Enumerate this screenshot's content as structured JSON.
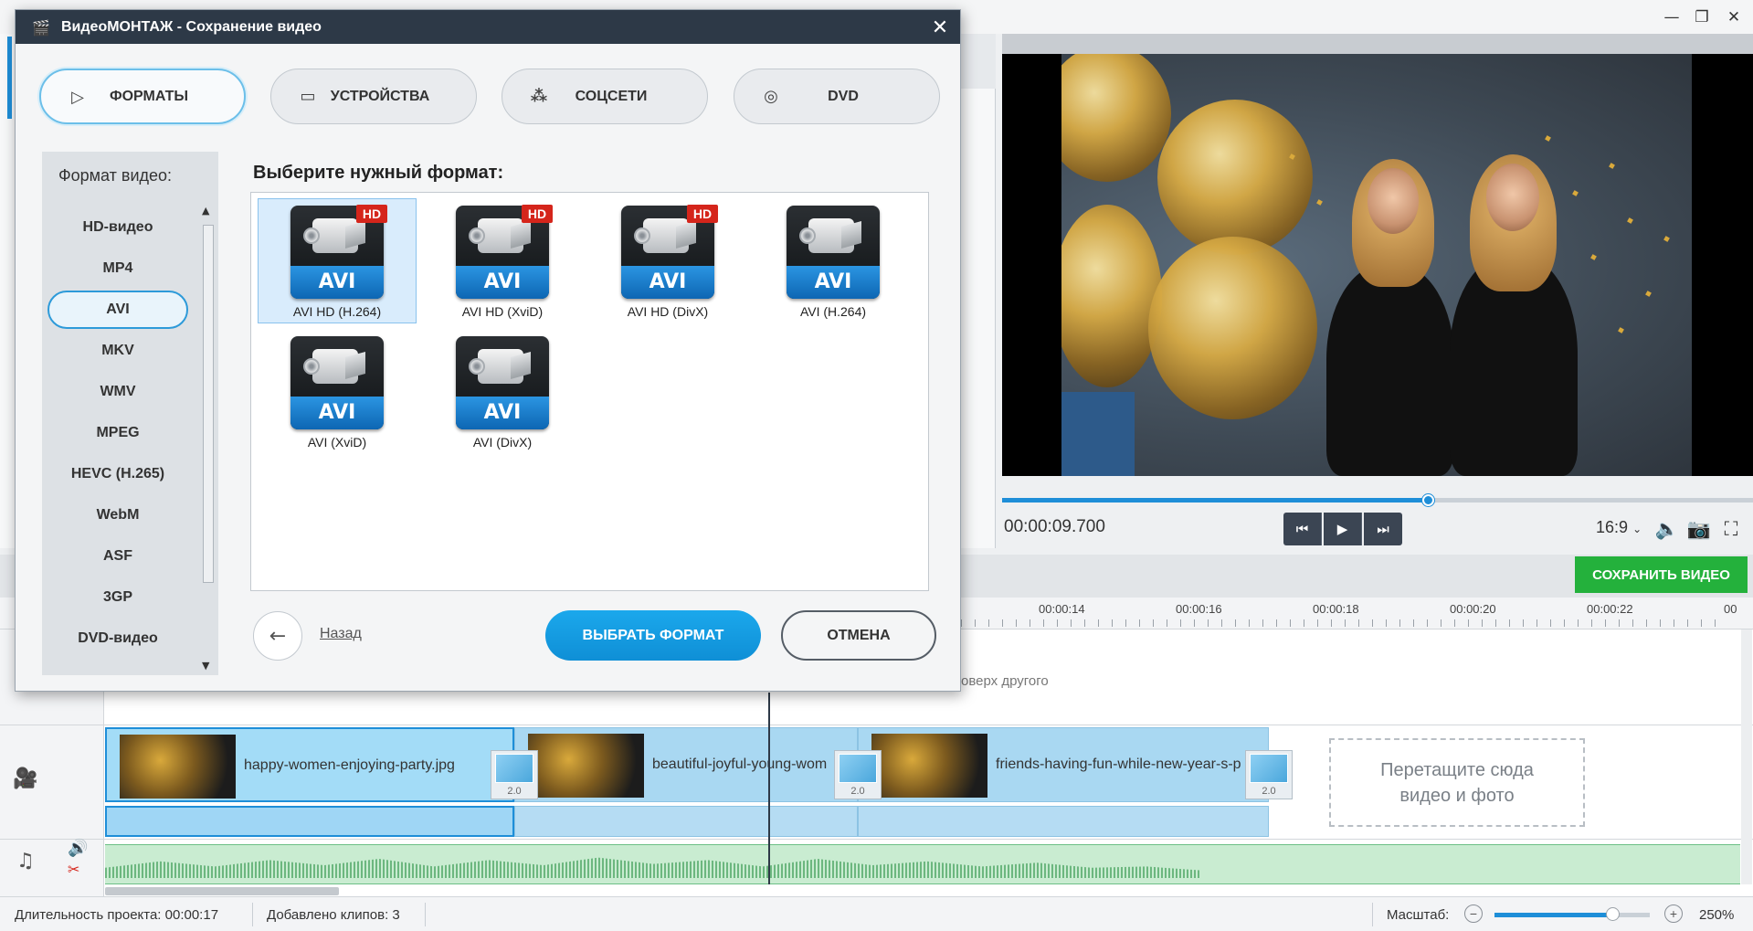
{
  "app": {
    "window_controls": [
      "—",
      "❐",
      "✕"
    ]
  },
  "preview": {
    "time": "00:00:09.700",
    "aspect_ratio": "16:9",
    "progress": 0.567
  },
  "save_button": "СОХРАНИТЬ ВИДЕО",
  "timeline": {
    "ruler_labels": [
      "00:00:14",
      "00:00:16",
      "00:00:18",
      "00:00:20",
      "00:00:22",
      "00"
    ],
    "overlay_hint": "оверх другого",
    "clips": [
      {
        "name": "happy-women-enjoying-party.jpg",
        "selected": true
      },
      {
        "name": "beautiful-joyful-young-wom",
        "selected": false
      },
      {
        "name": "friends-having-fun-while-new-year-s-p",
        "selected": false
      }
    ],
    "transitions": [
      "2.0",
      "2.0",
      "2.0"
    ],
    "drop_zone": "Перетащите сюда\nвидео и фото"
  },
  "status": {
    "duration": "Длительность проекта:  00:00:17",
    "clips_added": "Добавлено клипов: 3",
    "zoom_label": "Масштаб:",
    "zoom_value": "250%",
    "zoom_level": 0.76
  },
  "dialog": {
    "title": "ВидеоМОНТАЖ - Сохранение видео",
    "tabs": [
      {
        "label": "ФОРМАТЫ",
        "icon": "play-square-icon",
        "active": true
      },
      {
        "label": "УСТРОЙСТВА",
        "icon": "monitor-icon",
        "active": false
      },
      {
        "label": "СОЦСЕТИ",
        "icon": "share-icon",
        "active": false
      },
      {
        "label": "DVD",
        "icon": "disc-icon",
        "active": false
      }
    ],
    "format_panel_title": "Формат видео:",
    "formats": [
      "HD-видео",
      "MP4",
      "AVI",
      "MKV",
      "WMV",
      "MPEG",
      "HEVC (H.265)",
      "WebM",
      "ASF",
      "3GP",
      "DVD-видео"
    ],
    "active_format": "AVI",
    "choose_title": "Выберите нужный формат:",
    "cards": [
      {
        "caption": "AVI HD (H.264)",
        "badge": "HD",
        "label": "AVI",
        "selected": true
      },
      {
        "caption": "AVI HD (XviD)",
        "badge": "HD",
        "label": "AVI",
        "selected": false
      },
      {
        "caption": "AVI HD (DivX)",
        "badge": "HD",
        "label": "AVI",
        "selected": false
      },
      {
        "caption": "AVI (H.264)",
        "badge": "",
        "label": "AVI",
        "selected": false
      },
      {
        "caption": "AVI (XviD)",
        "badge": "",
        "label": "AVI",
        "selected": false
      },
      {
        "caption": "AVI (DivX)",
        "badge": "",
        "label": "AVI",
        "selected": false
      }
    ],
    "back_label": "Назад",
    "choose_button": "ВЫБРАТЬ ФОРМАТ",
    "cancel_button": "ОТМЕНА"
  }
}
